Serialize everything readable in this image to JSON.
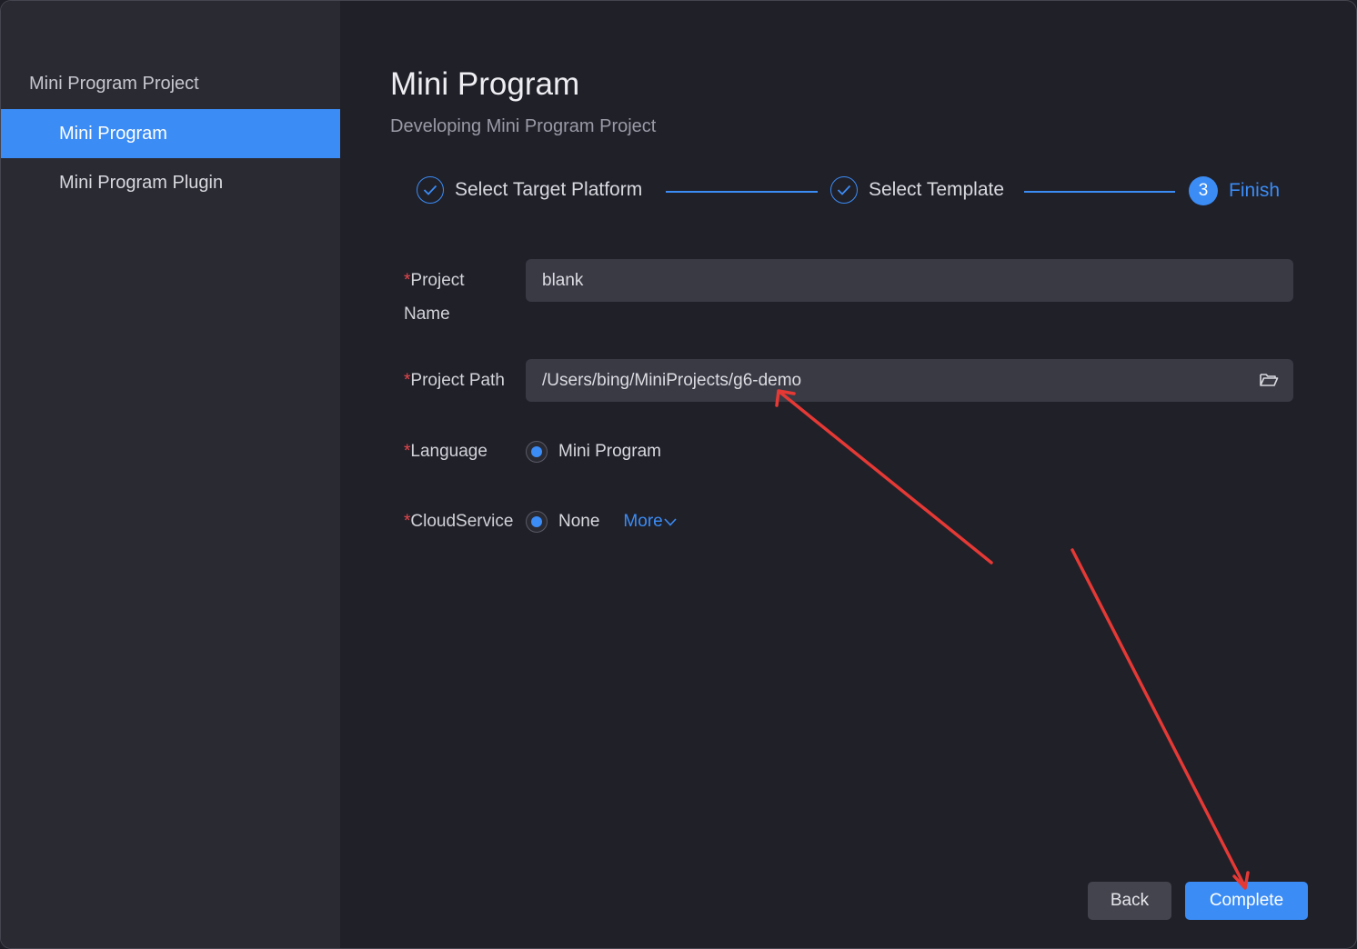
{
  "window": {
    "traffic_lights": [
      "close",
      "minimize",
      "zoom"
    ]
  },
  "sidebar": {
    "group_label": "Mini Program Project",
    "items": [
      {
        "label": "Mini Program",
        "active": true
      },
      {
        "label": "Mini Program Plugin",
        "active": false
      }
    ]
  },
  "header": {
    "title": "Mini Program",
    "subtitle": "Developing Mini Program Project"
  },
  "steps": [
    {
      "label": "Select Target Platform",
      "state": "done",
      "icon": "check-circle-icon"
    },
    {
      "label": "Select Template",
      "state": "done",
      "icon": "check-circle-icon"
    },
    {
      "label": "Finish",
      "state": "active",
      "number": "3"
    }
  ],
  "form": {
    "required_mark": "*",
    "project_name": {
      "label_line1": "Project",
      "label_line2": "Name",
      "value": "blank"
    },
    "project_path": {
      "label": "Project Path",
      "value": "/Users/bing/MiniProjects/g6-demo",
      "icon": "folder-open-icon"
    },
    "language": {
      "label": "Language",
      "option": "Mini Program",
      "selected": true
    },
    "cloud_service": {
      "label": "CloudService",
      "option": "None",
      "selected": true,
      "more_label": "More"
    }
  },
  "buttons": {
    "back": "Back",
    "complete": "Complete"
  },
  "colors": {
    "accent": "#3b8cf5",
    "required": "#e5484d",
    "annotation_arrow": "#e53935",
    "background": "#202029",
    "sidebar": "#2a2a33"
  }
}
